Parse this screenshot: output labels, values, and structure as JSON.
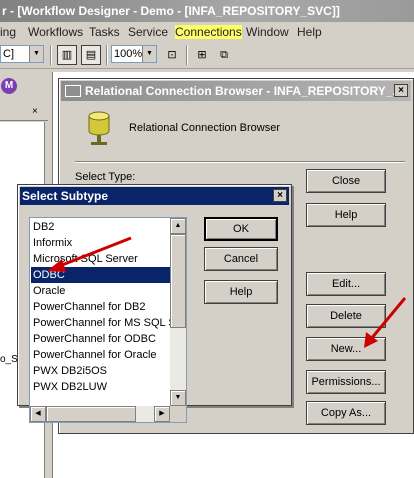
{
  "app": {
    "title": "r - [Workflow Designer - Demo - [INFA_REPOSITORY_SVC]]",
    "menu": [
      "ing",
      "Workflows",
      "Tasks",
      "Service",
      "Connections",
      "Window",
      "Help"
    ],
    "highlight_menu": "Connections",
    "toolbar": {
      "combo_left_value": "C]",
      "zoom_value": "100%"
    }
  },
  "navigator": {
    "logo_letter": "M",
    "close_glyph": "×",
    "fragment_text": "o_Se"
  },
  "connection_browser": {
    "title": "Relational Connection Browser - INFA_REPOSITORY_...",
    "heading": "Relational Connection Browser",
    "select_type_label": "Select Type:",
    "close_glyph": "×",
    "buttons": {
      "close": "Close",
      "help": "Help",
      "edit": "Edit...",
      "delete": "Delete",
      "new": "New...",
      "permissions": "Permissions...",
      "copy_as": "Copy As..."
    }
  },
  "subtype_dialog": {
    "title": "Select Subtype",
    "close_glyph": "×",
    "items": [
      "DB2",
      "Informix",
      "Microsoft SQL Server",
      "ODBC",
      "Oracle",
      "PowerChannel for DB2",
      "PowerChannel for MS SQL Se",
      "PowerChannel for ODBC",
      "PowerChannel for Oracle",
      "PWX DB2i5OS",
      "PWX DB2LUW"
    ],
    "selected": "ODBC",
    "buttons": {
      "ok": "OK",
      "cancel": "Cancel",
      "help": "Help"
    }
  },
  "colors": {
    "selection": "#0a246a",
    "annotation_arrow": "#cc0000",
    "menu_highlight": "#ffff66"
  }
}
